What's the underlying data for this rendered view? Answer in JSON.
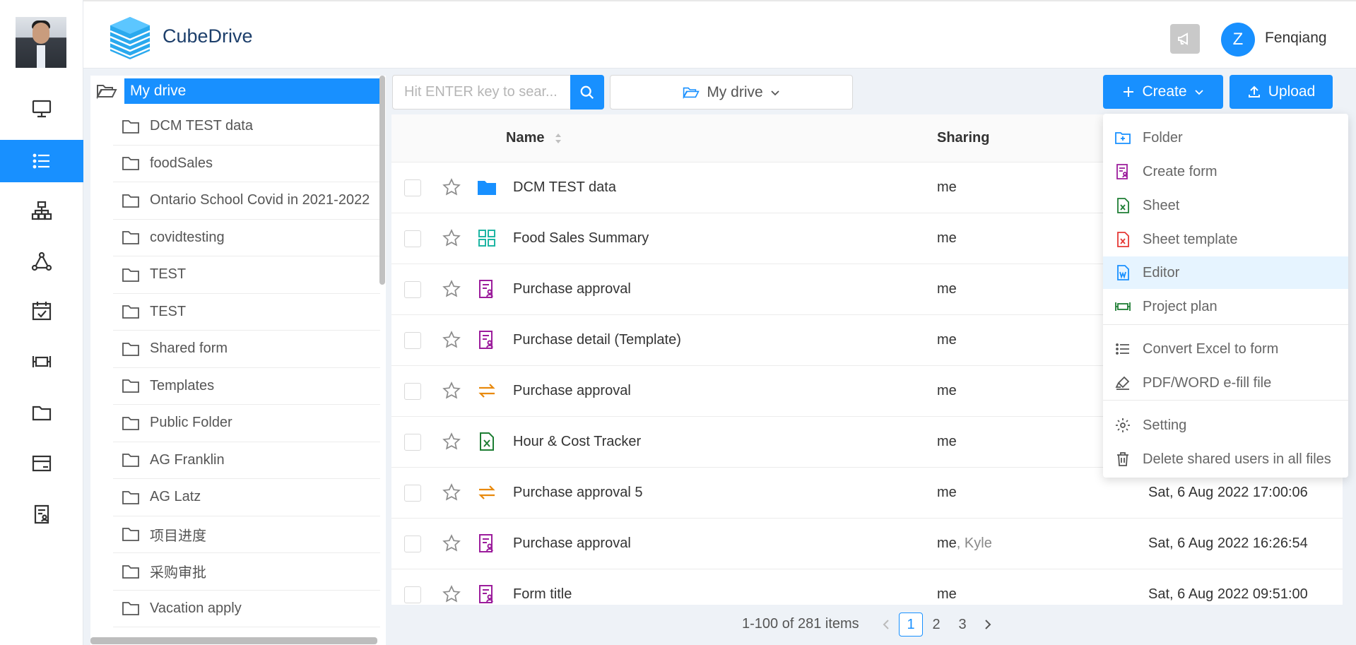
{
  "app": {
    "brand": "CubeDrive"
  },
  "user": {
    "initial": "Z",
    "name": "Fenqiang"
  },
  "tree": {
    "root_label": "My drive",
    "folders": [
      "DCM TEST data",
      "foodSales",
      "Ontario School Covid in 2021-2022",
      "covidtesting",
      "TEST",
      "TEST",
      "Shared form",
      "Templates",
      "Public Folder",
      "AG Franklin",
      "AG Latz",
      "项目进度",
      "采购审批",
      "Vacation apply"
    ]
  },
  "toolbar": {
    "search_placeholder": "Hit ENTER key to sear...",
    "path_label": "My drive",
    "create_label": "Create",
    "upload_label": "Upload"
  },
  "table": {
    "col_name": "Name",
    "col_sharing": "Sharing",
    "rows": [
      {
        "name": "DCM TEST data",
        "sharing": "me",
        "sharing_extra": "",
        "date": "",
        "icon": "folder-icon"
      },
      {
        "name": "Food Sales Summary",
        "sharing": "me",
        "sharing_extra": "",
        "date": "",
        "icon": "dashboard-icon"
      },
      {
        "name": "Purchase approval",
        "sharing": "me",
        "sharing_extra": "",
        "date": "",
        "icon": "form-icon"
      },
      {
        "name": "Purchase detail (Template)",
        "sharing": "me",
        "sharing_extra": "",
        "date": "",
        "icon": "form-icon"
      },
      {
        "name": "Purchase approval",
        "sharing": "me",
        "sharing_extra": "",
        "date": "",
        "icon": "workflow-icon"
      },
      {
        "name": "Hour & Cost Tracker",
        "sharing": "me",
        "sharing_extra": "",
        "date": "",
        "icon": "sheet-icon"
      },
      {
        "name": "Purchase approval 5",
        "sharing": "me",
        "sharing_extra": "",
        "date": "Sat, 6 Aug 2022 17:00:06",
        "icon": "workflow-icon"
      },
      {
        "name": "Purchase approval",
        "sharing": "me",
        "sharing_extra": ", Kyle",
        "date": "Sat, 6 Aug 2022 16:26:54",
        "icon": "form-icon"
      },
      {
        "name": "Form title",
        "sharing": "me",
        "sharing_extra": "",
        "date": "Sat, 6 Aug 2022 09:51:00",
        "icon": "form-icon"
      }
    ]
  },
  "pagination": {
    "summary": "1-100 of 281 items",
    "pages": [
      "1",
      "2",
      "3"
    ],
    "current": "1"
  },
  "create_menu": {
    "items": [
      "Folder",
      "Create form",
      "Sheet",
      "Sheet template",
      "Editor",
      "Project plan",
      "Convert Excel to form",
      "PDF/WORD e-fill file",
      "Setting",
      "Delete shared users in all files"
    ],
    "highlighted": "Editor"
  },
  "colors": {
    "primary": "#1890ff",
    "form": "#9c1d9c",
    "sheet": "#1e7e34",
    "template": "#e53935",
    "workflow": "#e8890c",
    "dashboard": "#1fb6a4"
  }
}
